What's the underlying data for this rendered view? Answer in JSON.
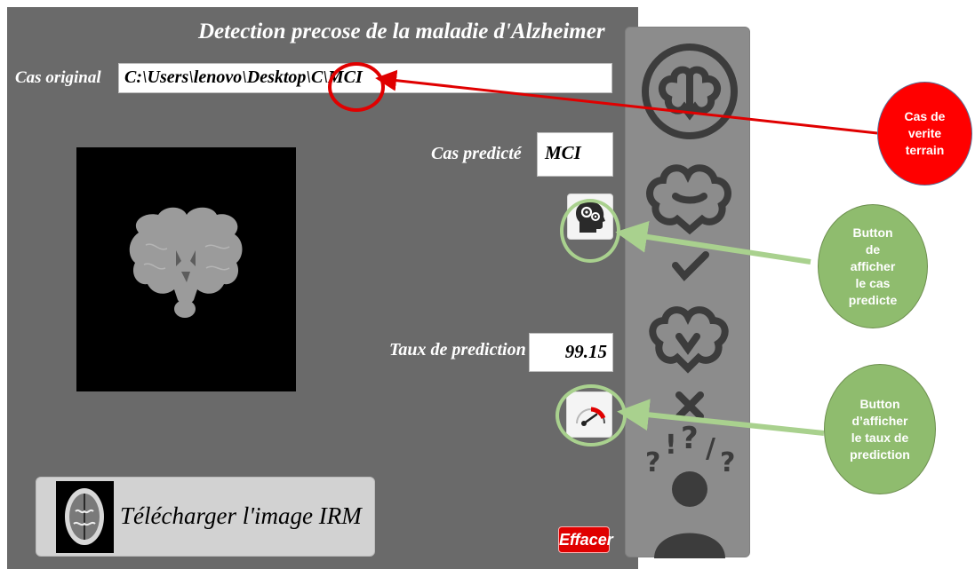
{
  "app": {
    "title": "Detection precose de la maladie d'Alzheimer",
    "original_case_label": "Cas original",
    "original_case_value": "C:\\Users\\lenovo\\Desktop\\C\\MCI",
    "predicted_case_label": "Cas predicté",
    "predicted_case_value": "MCI",
    "prediction_rate_label": "Taux de prediction",
    "prediction_rate_value": "99.15",
    "upload_button_label": "Télécharger l'image IRM",
    "clear_button_label": "Effacer",
    "side_panel_icons": [
      "brain-icon",
      "brain-check-icon",
      "brain-cross-icon",
      "confused-person-icon"
    ]
  },
  "annotations": {
    "ground_truth": "Cas de\nverite\nterrain",
    "predict_button": "Button\nde\nafficher\nle cas\npredicte",
    "rate_button": "Button\nd’afficher\nle taux de\nprediction"
  },
  "colors": {
    "panel_bg": "#6a6a6a",
    "red": "#ff0000",
    "green_note": "#8fbc6e",
    "green_arrow": "#a9d18e",
    "clear_button": "#e00000"
  }
}
